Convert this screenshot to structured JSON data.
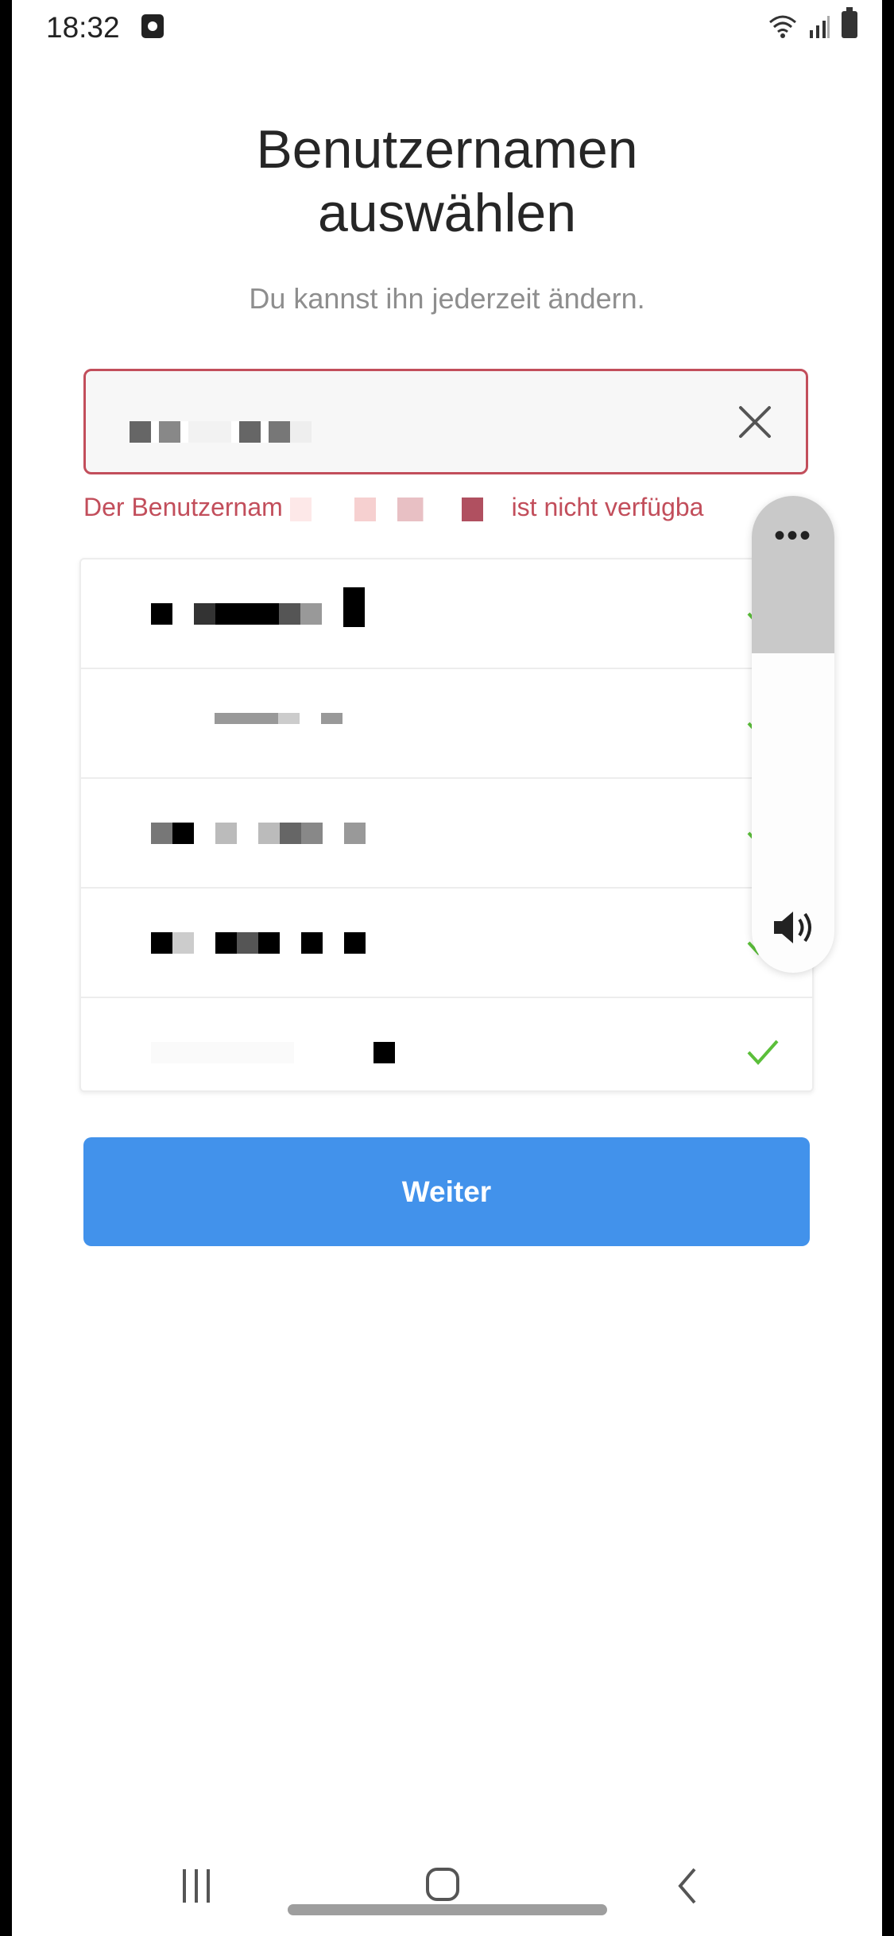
{
  "status_bar": {
    "time": "18:32"
  },
  "screen": {
    "title_line1": "Benutzernamen",
    "title_line2": "auswählen",
    "subtitle": "Du kannst ihn jederzeit ändern."
  },
  "username_field": {
    "value": "",
    "redacted": true
  },
  "error": {
    "prefix": "Der Benutzernam",
    "suffix": "ist nicht verfügba"
  },
  "suggestions": {
    "items": [
      {
        "label": "",
        "redacted": true
      },
      {
        "label": "",
        "redacted": true
      },
      {
        "label": "",
        "redacted": true
      },
      {
        "label": "",
        "redacted": true
      },
      {
        "label": "",
        "redacted": true
      }
    ]
  },
  "actions": {
    "next_label": "Weiter"
  },
  "volume_panel": {
    "more_label": "•••",
    "level_percent": 33
  },
  "colors": {
    "error": "#c24e5b",
    "accent": "#4292eb",
    "check": "#5bbf3a"
  }
}
